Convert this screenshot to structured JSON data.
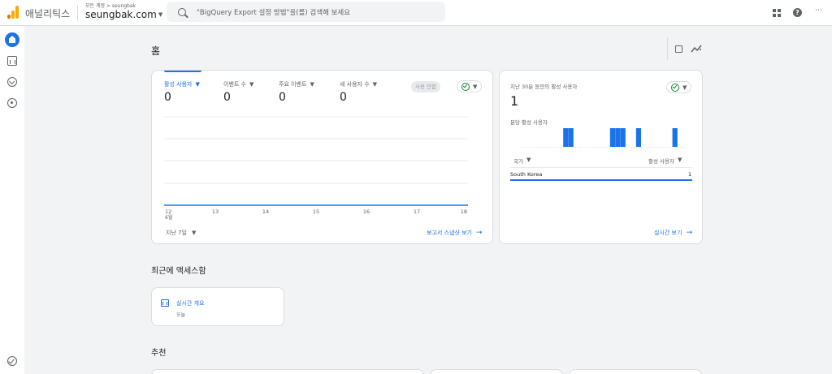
{
  "topbar": {
    "app_title": "애널리틱스",
    "breadcrumb": "모든 계정 > seungbak",
    "account": "seungbak.com",
    "search_placeholder": "\"BigQuery Export 설정 방법\"을(를) 검색해 보세요"
  },
  "page": {
    "title": "홈"
  },
  "overview": {
    "metrics": [
      {
        "label": "활성 사용자",
        "value": "0"
      },
      {
        "label": "이벤트 수",
        "value": "0"
      },
      {
        "label": "주요 이벤트",
        "value": "0"
      },
      {
        "label": "새 사용자 수",
        "value": "0"
      }
    ],
    "compare_button": "사용 안함",
    "x_labels": [
      "12",
      "13",
      "14",
      "15",
      "16",
      "17",
      "18"
    ],
    "x_month": "6월",
    "date_range": "지난 7일",
    "snapshot_link": "보고서 스냅샷 보기"
  },
  "realtime": {
    "title": "지난 30분 동안의 활성 사용자",
    "value": "1",
    "subtitle": "분당 활성 사용자",
    "col_country": "국가",
    "col_users": "활성 사용자",
    "rows": [
      {
        "country": "South Korea",
        "users": "1"
      }
    ],
    "link": "실시간 보기",
    "bar_minutes": [
      8,
      9,
      17,
      18,
      19,
      22,
      29
    ]
  },
  "recent": {
    "section_title": "최근에 액세스함",
    "items": [
      {
        "title": "실시간 개요",
        "subtitle": "오늘"
      }
    ]
  },
  "recommended": {
    "section_title": "추천"
  },
  "colors": {
    "accent": "#1a73e8",
    "success": "#188038",
    "brand_orange": "#f9ab00"
  }
}
